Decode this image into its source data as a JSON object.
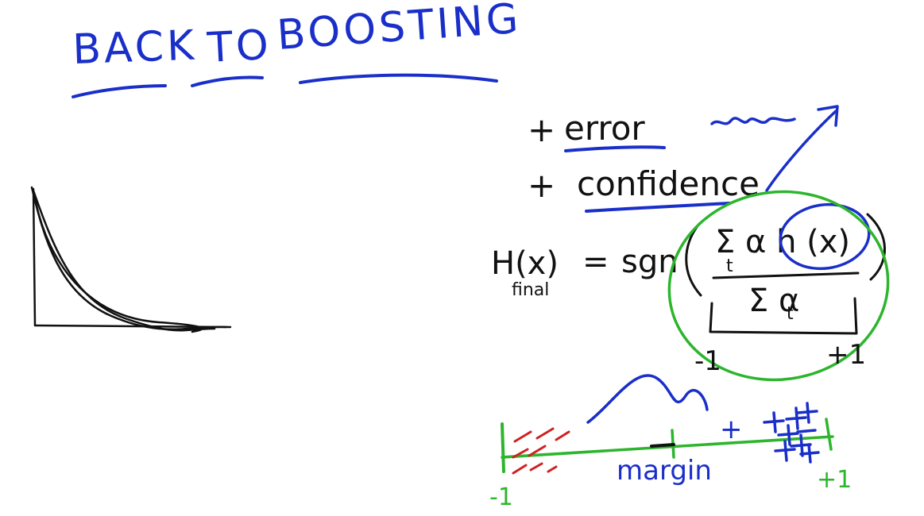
{
  "colors": {
    "black_ink": "#111111",
    "blue_ink": "#1a2fc9",
    "green_ink": "#2db52d",
    "red_ink": "#d02020",
    "background": "#ffffff"
  },
  "title": {
    "back": "BACK",
    "to": "TO",
    "boosting": "BOOSTING"
  },
  "notes": {
    "error_plus": "+",
    "error_word": "error",
    "confidence_plus": "+",
    "confidence_word": "confidence"
  },
  "formula": {
    "lhs": "H(x)",
    "lhs_subscript": "final",
    "equals": "=",
    "sgn": "sgn",
    "numerator": "Σ α h (x)",
    "numerator_sub_t": "t",
    "denominator": "Σ α",
    "denominator_sub_t": "t"
  },
  "range_labels": {
    "minus_one": "-1",
    "plus_one": "+1"
  },
  "number_line": {
    "left_label": "-1",
    "right_label": "+1",
    "margin_label": "margin",
    "plus_mark": "+"
  }
}
